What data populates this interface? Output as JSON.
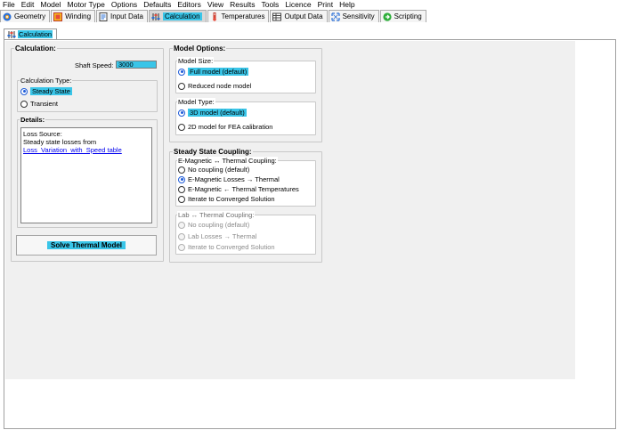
{
  "menu": [
    {
      "label": "File",
      "underline": "F"
    },
    {
      "label": "Edit",
      "underline": "E"
    },
    {
      "label": "Model",
      "underline": "M"
    },
    {
      "label": "Motor Type",
      "underline": "T"
    },
    {
      "label": "Options",
      "underline": "O"
    },
    {
      "label": "Defaults",
      "underline": "D"
    },
    {
      "label": "Editors",
      "underline": "E"
    },
    {
      "label": "View",
      "underline": "V"
    },
    {
      "label": "Results",
      "underline": "R"
    },
    {
      "label": "Tools",
      "underline": "l"
    },
    {
      "label": "Licence",
      "underline": "L"
    },
    {
      "label": "Print",
      "underline": "P"
    },
    {
      "label": "Help",
      "underline": "H"
    }
  ],
  "tabs": [
    {
      "label": "Geometry",
      "icon": "geometry-icon"
    },
    {
      "label": "Winding",
      "icon": "winding-icon"
    },
    {
      "label": "Input Data",
      "icon": "input-data-icon"
    },
    {
      "label": "Calculation",
      "icon": "calculation-icon",
      "active": true
    },
    {
      "label": "Temperatures",
      "icon": "thermometer-icon"
    },
    {
      "label": "Output Data",
      "icon": "output-data-icon"
    },
    {
      "label": "Sensitivity",
      "icon": "sensitivity-icon"
    },
    {
      "label": "Scripting",
      "icon": "scripting-icon"
    }
  ],
  "subtab": {
    "label": "Calculation",
    "icon": "calculation-icon"
  },
  "calculation": {
    "title": "Calculation:",
    "shaft_speed_label": "Shaft Speed:",
    "shaft_speed_value": "3000",
    "calc_type_title": "Calculation Type:",
    "steady_state": "Steady State",
    "transient": "Transient",
    "details_title": "Details:",
    "details_line1": "Loss Source:",
    "details_line2": "Steady state losses from",
    "details_link": "Loss_Variation_with_Speed table",
    "solve_button": "Solve Thermal Model"
  },
  "model_options": {
    "title": "Model Options:",
    "size_title": "Model Size:",
    "full_model": "Full model (default)",
    "reduced_model": "Reduced node model",
    "type_title": "Model Type:",
    "model_3d": "3D model (default)",
    "model_2d": "2D model for FEA calibration"
  },
  "coupling": {
    "title": "Steady State Coupling:",
    "em_title": "E-Magnetic ↔ Thermal Coupling:",
    "em_options": [
      {
        "label": "No coupling (default)",
        "selected": false
      },
      {
        "label": "E-Magnetic Losses → Thermal",
        "selected": true
      },
      {
        "label": "E-Magnetic ← Thermal Temperatures",
        "selected": false
      },
      {
        "label": "Iterate to Converged Solution",
        "selected": false
      }
    ],
    "lab_title": "Lab ↔ Thermal Coupling:",
    "lab_options": [
      {
        "label": "No coupling (default)",
        "selected": true
      },
      {
        "label": "Lab Losses → Thermal",
        "selected": false
      },
      {
        "label": "Iterate to Converged Solution",
        "selected": false
      }
    ]
  },
  "colors": {
    "highlight": "#39c5e8",
    "radio_selected": "#1e5bd8",
    "link": "#0000ee",
    "panel_bg": "#f0f0f0"
  }
}
